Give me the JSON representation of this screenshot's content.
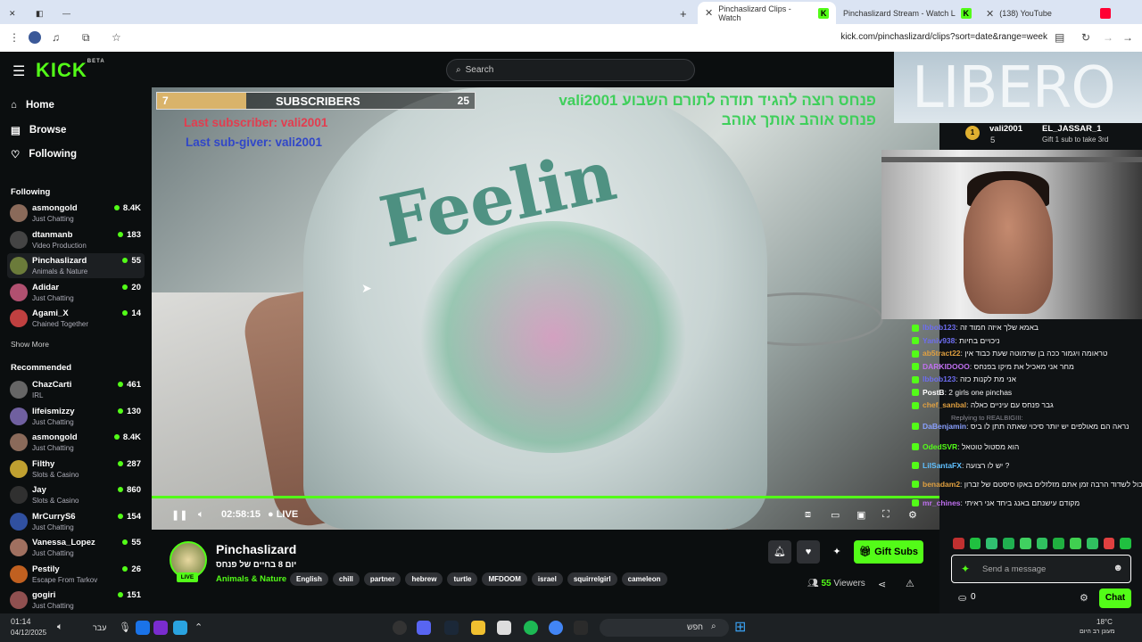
{
  "browser": {
    "tabs": [
      {
        "label": "Pinchaslizard Clips - Watch",
        "active": true
      },
      {
        "label": "Pinchaslizard Stream - Watch L",
        "active": false
      },
      {
        "label": "(138) YouTube",
        "active": false
      }
    ],
    "url": "kick.com/pinchaslizard/clips?sort=date&range=week"
  },
  "header": {
    "logo": "KICK",
    "logo_badge": "BETA",
    "search_placeholder": "Search"
  },
  "nav": {
    "home": "Home",
    "browse": "Browse",
    "following": "Following"
  },
  "following": {
    "title": "Following",
    "channels": [
      {
        "name": "asmongold",
        "category": "Just Chatting",
        "viewers": "8.4K",
        "color": "#8a6a5a"
      },
      {
        "name": "dtanmanb",
        "category": "Video Production",
        "viewers": "183",
        "color": "#444"
      },
      {
        "name": "Pinchaslizard",
        "category": "Animals & Nature",
        "viewers": "55",
        "color": "#6b7b3a"
      },
      {
        "name": "Adidar",
        "category": "Just Chatting",
        "viewers": "20",
        "color": "#b05070"
      },
      {
        "name": "Agami_X",
        "category": "Chained Together",
        "viewers": "14",
        "color": "#c04040"
      }
    ],
    "show_more": "Show More"
  },
  "recommended": {
    "title": "Recommended",
    "channels": [
      {
        "name": "ChazCarti",
        "category": "IRL",
        "viewers": "461",
        "color": "#666"
      },
      {
        "name": "lifeismizzy",
        "category": "Just Chatting",
        "viewers": "130",
        "color": "#7060a0"
      },
      {
        "name": "asmongold",
        "category": "Just Chatting",
        "viewers": "8.4K",
        "color": "#8a6a5a"
      },
      {
        "name": "Filthy",
        "category": "Slots & Casino",
        "viewers": "287",
        "color": "#c0a030"
      },
      {
        "name": "Jay",
        "category": "Slots & Casino",
        "viewers": "860",
        "color": "#303030"
      },
      {
        "name": "MrCurryS6",
        "category": "Just Chatting",
        "viewers": "154",
        "color": "#3050a0"
      },
      {
        "name": "Vanessa_Lopez",
        "category": "Just Chatting",
        "viewers": "55",
        "color": "#a07060"
      },
      {
        "name": "Pestily",
        "category": "Escape From Tarkov",
        "viewers": "26",
        "color": "#c06020"
      },
      {
        "name": "gogiri",
        "category": "Just Chatting",
        "viewers": "151",
        "color": "#905050"
      }
    ]
  },
  "overlay": {
    "sub_goal_current": "7",
    "sub_goal_title": "SUBSCRIBERS",
    "sub_goal_target": "25",
    "sub_goal_progress": 0.28,
    "last_subscriber": "Last subscriber: vali2001",
    "last_sub_giver": "Last sub-giver: vali2001",
    "hebrew_line1": "פנחס רוצה להגיד תודה לתורם השבוע vali2001",
    "hebrew_line2": "פנחס אוהב אותך אוהב"
  },
  "player": {
    "time": "02:58:15",
    "live": "LIVE",
    "progress": 1.0
  },
  "promo": {
    "brand": "LIBERO",
    "top_user": "vali2001",
    "top_count": "5",
    "second_user": "EL_JASSAR_1",
    "gift_cta": "Gift 1 sub to take 3rd"
  },
  "chat": {
    "messages": [
      {
        "user": "lbbob123",
        "text": "באמא שלך איזה חמוד זה",
        "color": "#6d6df0"
      },
      {
        "user": "Yaniv938",
        "text": "ניכויים בחיות",
        "color": "#6d6df0"
      },
      {
        "user": "ab5tract22",
        "text": "טראומה ויגמור ככה בן שרמוטה שעת כבוד אין",
        "color": "#e0a040"
      },
      {
        "user": "DARKIDOOO",
        "text": "מחר אני מאכיל את מיקו בפנחס",
        "color": "#c070f0"
      },
      {
        "user": "lbbob123",
        "text": "אני מת לקנות כזה",
        "color": "#6d6df0"
      },
      {
        "user": "PostB",
        "text": "2 girls one pinchas",
        "color": "#ffffff"
      },
      {
        "user": "chef_sanbal",
        "text": "גבר פנחס עם עיניים כאלה",
        "color": "#e0a040"
      },
      {
        "user": "DaBenjamin",
        "text": "נראה הם מאולפים יש יותר סיכוי שאתה תתן לו ביס",
        "color": "#8aa0ff",
        "reply": "Replying to REALBIGIII:"
      },
      {
        "user": "OdedSVR",
        "text": "הוא מסטול טוטאל",
        "color": "#53fc18"
      },
      {
        "user": "LilSantaFX",
        "text": "יש לו רצועה ?",
        "color": "#60c0ff"
      },
      {
        "user": "benadam2",
        "text": "שמע פנחס יכול לשדוד הרבה זמן אתם מזלזלים באקו סיסטם של זברון",
        "color": "#e0a040"
      },
      {
        "user": "mr_chines",
        "text": "מקודם עישנתם באנג ביחד אני ראיתי",
        "color": "#c070f0"
      }
    ],
    "input_placeholder": "Send a message",
    "points": "0",
    "chat_button": "Chat"
  },
  "stream": {
    "name": "Pinchaslizard",
    "title": "יום 8 בחיים של פנחס",
    "category": "Animals & Nature",
    "tags": [
      "English",
      "chill",
      "partner",
      "hebrew",
      "turtle",
      "MFDOOM",
      "israel",
      "squirrelgirl",
      "cameleon"
    ],
    "live_badge": "LIVE",
    "viewers": "55",
    "viewers_label": "Viewers",
    "gift_button": "Gift Subs"
  },
  "taskbar": {
    "time": "01:14",
    "date": "04/12/2025",
    "lang": "עבר",
    "search": "חפש",
    "temp": "18°C",
    "weather": "מעונן רב היום"
  }
}
